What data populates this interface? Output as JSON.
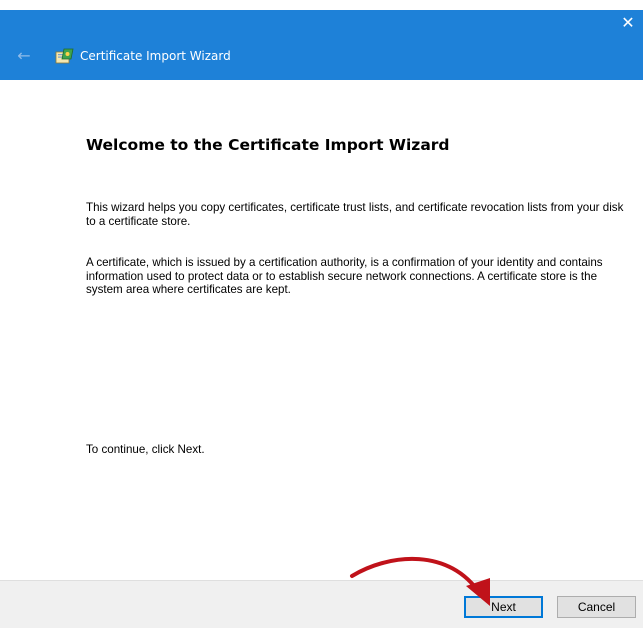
{
  "window": {
    "title": "Certificate Import Wizard",
    "close_glyph": "✕",
    "back_glyph": "←",
    "accent_color": "#1e81d8"
  },
  "main": {
    "heading": "Welcome to the Certificate Import Wizard",
    "paragraph_1": "This wizard helps you copy certificates, certificate trust lists, and certificate revocation lists from your disk to a certificate store.",
    "paragraph_2": "A certificate, which is issued by a certification authority, is a confirmation of your identity and contains information used to protect data or to establish secure network connections. A certificate store is the system area where certificates are kept.",
    "paragraph_3": "To continue, click Next."
  },
  "footer": {
    "next_label": "Next",
    "cancel_label": "Cancel"
  },
  "icons": {
    "app_icon": "certificate-wizard-icon",
    "back_icon": "back-arrow-icon",
    "close_icon": "close-icon",
    "annotation": "red-curved-arrow-icon"
  },
  "annotation_color": "#c0121a"
}
